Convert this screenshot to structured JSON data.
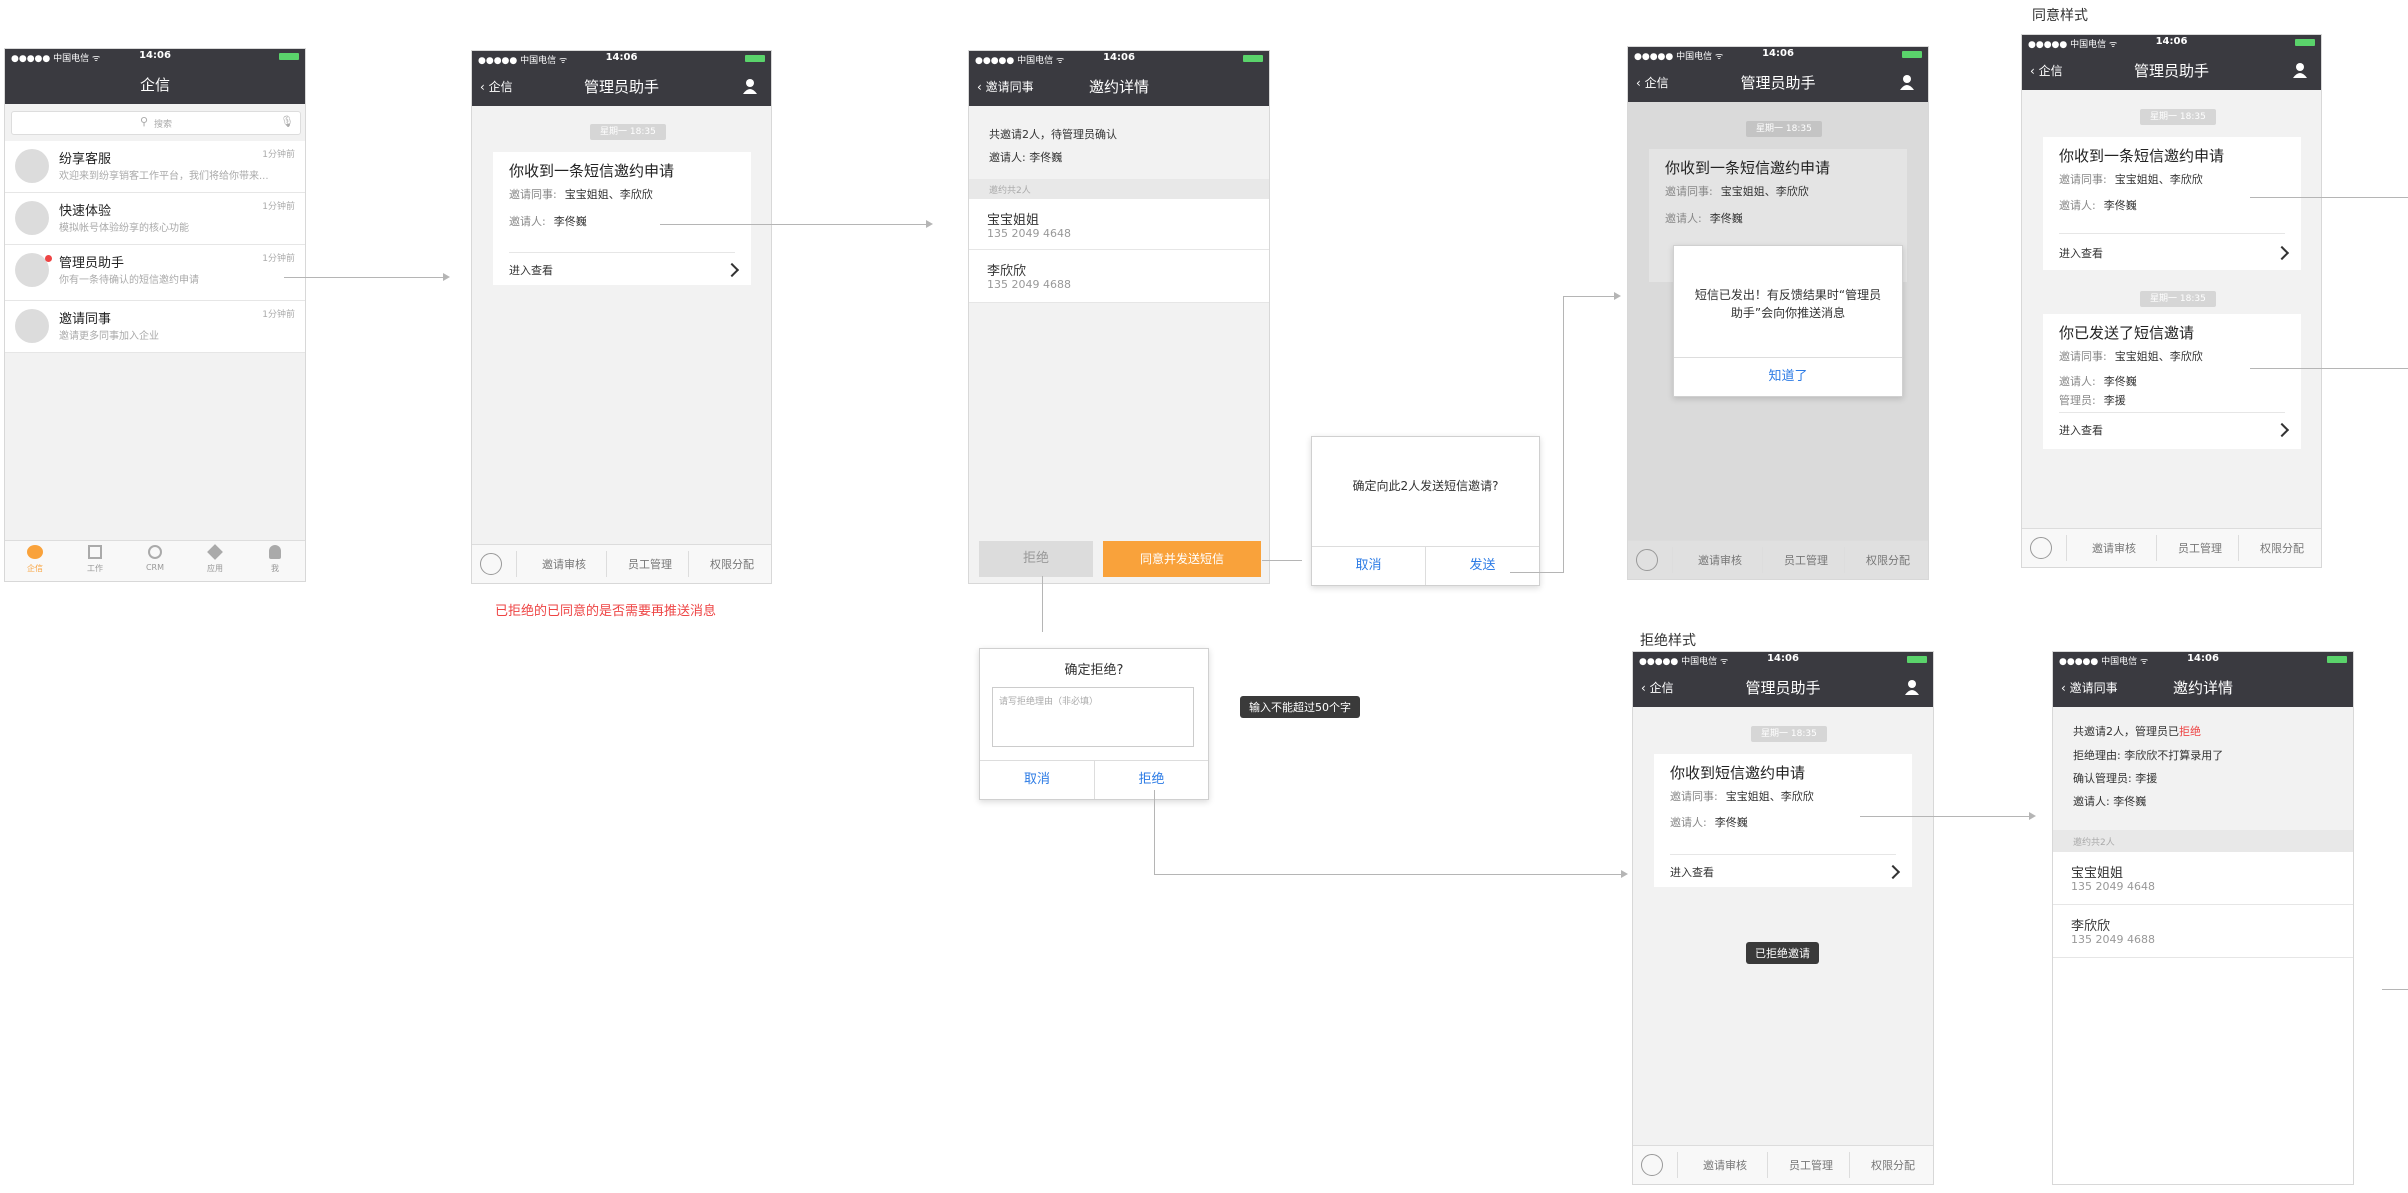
{
  "status": {
    "carrier": "●●●●● 中国电信 ᯤ",
    "time": "14:06"
  },
  "labels": {
    "agree_style": "同意样式",
    "reject_style": "拒绝样式",
    "remark": "已拒绝的已同意的是否需要再推送消息",
    "toast_50": "输入不能超过50个字",
    "toast_rejected": "已拒绝邀请"
  },
  "s1": {
    "title": "企信",
    "search": "搜索",
    "items": [
      {
        "name": "纷享客服",
        "sub": "欢迎来到纷享销客工作平台，我们将给你带来...",
        "time": "1分钟前"
      },
      {
        "name": "快速体验",
        "sub": "模拟帐号体验纷享的核心功能",
        "time": "1分钟前"
      },
      {
        "name": "管理员助手",
        "sub": "你有一条待确认的短信邀约申请",
        "time": "1分钟前"
      },
      {
        "name": "邀请同事",
        "sub": "邀请更多同事加入企业",
        "time": "1分钟前"
      }
    ],
    "tabs": [
      "企信",
      "工作",
      "CRM",
      "应用",
      "我"
    ]
  },
  "assistant": {
    "back": "企信",
    "title": "管理员助手",
    "timestamp": "星期一 18:35",
    "card_title": "你收到一条短信邀约申请",
    "card_title_reject": "你收到短信邀约申请",
    "colleagues_label": "邀请同事:",
    "colleagues": "宝宝姐姐、李欣欣",
    "inviter_label": "邀请人:",
    "inviter": "李佟巍",
    "enter": "进入查看",
    "bottom": [
      "邀请审核",
      "员工管理",
      "权限分配"
    ]
  },
  "detail": {
    "back": "邀请同事",
    "title": "邀约详情",
    "summary": "共邀请2人，待管理员确认",
    "inviter_line": "邀请人: 李佟巍",
    "section": "邀约共2人",
    "contacts": [
      {
        "name": "宝宝姐姐",
        "phone": "135 2049 4648"
      },
      {
        "name": "李欣欣",
        "phone": "135 2049 4688"
      }
    ],
    "reject_btn": "拒绝",
    "agree_btn": "同意并发送短信"
  },
  "confirm_send": {
    "msg": "确定向此2人发送短信邀请?",
    "cancel": "取消",
    "send": "发送"
  },
  "confirm_reject": {
    "title": "确定拒绝?",
    "placeholder": "请写拒绝理由（非必填）",
    "cancel": "取消",
    "reject": "拒绝"
  },
  "sent_dialog": {
    "msg": "短信已发出！有反馈结果时“管理员助手”会向你推送消息",
    "ok": "知道了"
  },
  "agree_panel": {
    "card1": "你收到一条短信邀约申请",
    "card2": "你已发送了短信邀请",
    "admin_label": "管理员:",
    "admin": "李援"
  },
  "reject_detail": {
    "summary_prefix": "共邀请2人，管理员已",
    "summary_red": "拒绝",
    "reason": "拒绝理由: 李欣欣不打算录用了",
    "confirm_admin": "确认管理员: 李援",
    "inviter_line": "邀请人: 李佟巍"
  },
  "colors": {
    "dark": "#3a3a40",
    "orange": "#f9a23b",
    "blue": "#2c7be5",
    "red": "#ee4444",
    "badge": "#f5a623"
  }
}
